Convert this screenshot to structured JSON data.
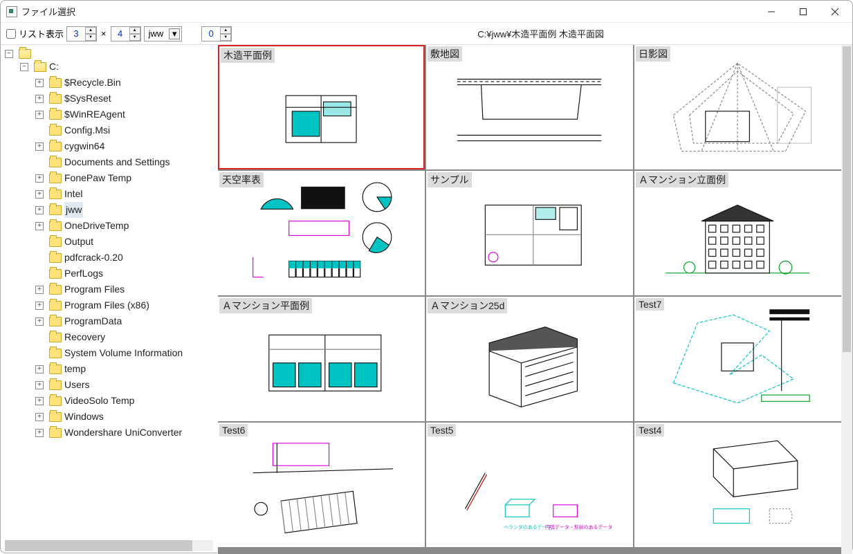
{
  "window": {
    "title": "ファイル選択"
  },
  "toolbar": {
    "list_view_label": "リスト表示",
    "cols_value": "3",
    "x_label": "×",
    "rows_value": "4",
    "ext_value": "jww",
    "zero_value": "0",
    "path": "C:¥jww¥木造平面例  木造平面図"
  },
  "tree": {
    "root": "",
    "drive": "C:",
    "items": [
      {
        "label": "$Recycle.Bin",
        "exp": true
      },
      {
        "label": "$SysReset",
        "exp": true
      },
      {
        "label": "$WinREAgent",
        "exp": true
      },
      {
        "label": "Config.Msi",
        "exp": false
      },
      {
        "label": "cygwin64",
        "exp": true
      },
      {
        "label": "Documents and Settings",
        "exp": false
      },
      {
        "label": "FonePaw Temp",
        "exp": true
      },
      {
        "label": "Intel",
        "exp": true
      },
      {
        "label": "jww",
        "exp": true,
        "selected": true
      },
      {
        "label": "OneDriveTemp",
        "exp": true
      },
      {
        "label": "Output",
        "exp": false
      },
      {
        "label": "pdfcrack-0.20",
        "exp": false
      },
      {
        "label": "PerfLogs",
        "exp": false
      },
      {
        "label": "Program Files",
        "exp": true
      },
      {
        "label": "Program Files (x86)",
        "exp": true
      },
      {
        "label": "ProgramData",
        "exp": true
      },
      {
        "label": "Recovery",
        "exp": false
      },
      {
        "label": "System Volume Information",
        "exp": false
      },
      {
        "label": "temp",
        "exp": true
      },
      {
        "label": "Users",
        "exp": true
      },
      {
        "label": "VideoSolo Temp",
        "exp": true
      },
      {
        "label": "Windows",
        "exp": true
      },
      {
        "label": "Wondershare UniConverter",
        "exp": true
      }
    ]
  },
  "thumbnails": [
    {
      "caption": "木造平面例",
      "selected": true,
      "kind": "floorplan"
    },
    {
      "caption": "敷地図",
      "kind": "site"
    },
    {
      "caption": "日影図",
      "kind": "shadow"
    },
    {
      "caption": "天空率表",
      "kind": "sky"
    },
    {
      "caption": "サンプル",
      "kind": "sample"
    },
    {
      "caption": "Ａマンション立面例",
      "kind": "elevation"
    },
    {
      "caption": "Ａマンション平面例",
      "kind": "mansion-plan"
    },
    {
      "caption": "Ａマンション25d",
      "kind": "iso"
    },
    {
      "caption": "Test7",
      "kind": "test7"
    },
    {
      "caption": "Test6",
      "kind": "test6"
    },
    {
      "caption": "Test5",
      "kind": "test5"
    },
    {
      "caption": "Test4",
      "kind": "test4"
    }
  ]
}
